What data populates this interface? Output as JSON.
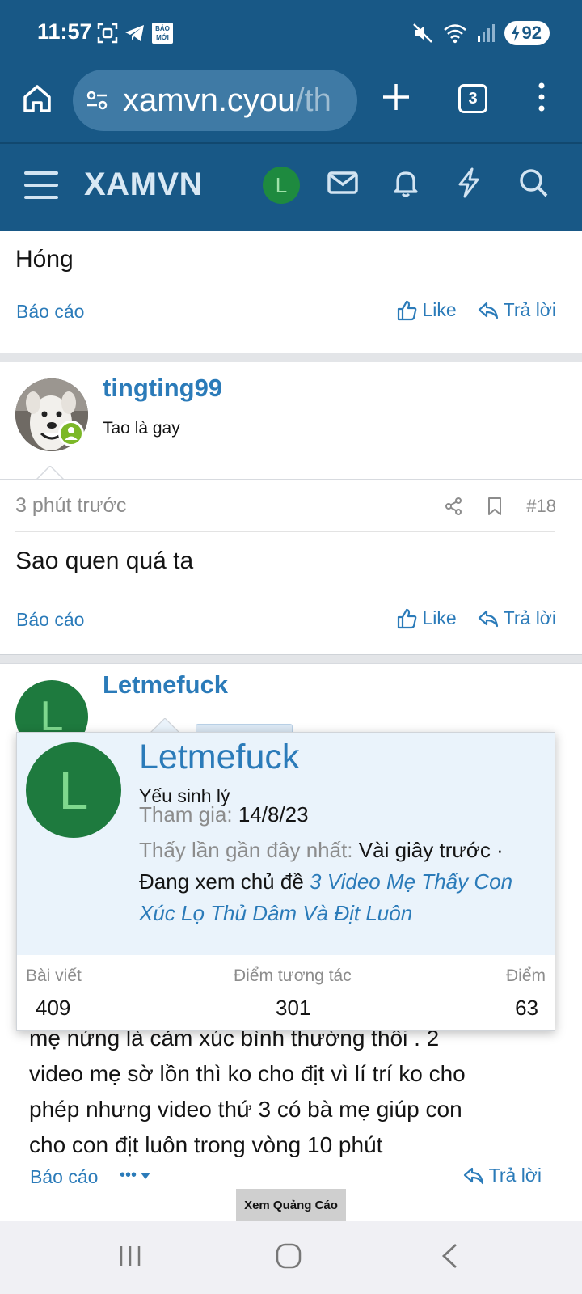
{
  "status_bar": {
    "time": "11:57",
    "battery": "92",
    "bao_moi_line1": "BÁO",
    "bao_moi_line2": "MỚI"
  },
  "browser": {
    "url_main": "xamvn.cyou",
    "url_rest": "/th",
    "tab_count": "3"
  },
  "site_header": {
    "logo": "XAMVN",
    "avatar_letter": "L"
  },
  "post_prev": {
    "text": "Hóng",
    "report": "Báo cáo",
    "like": "Like",
    "reply": "Trả lời"
  },
  "post_18": {
    "username": "tingting99",
    "user_title": "Tao là gay",
    "time": "3 phút trước",
    "number": "#18",
    "text": "Sao quen quá ta",
    "report": "Báo cáo",
    "like": "Like",
    "reply": "Trả lời"
  },
  "post_19": {
    "username": "Letmefuck",
    "avatar_letter": "L",
    "body_lines": [
      "mẹ nứng là cảm xúc bình thường thôi . 2",
      "video mẹ sờ lồn thì ko cho địt vì lí trí ko cho",
      "phép nhưng video thứ 3 có bà mẹ giúp con",
      "cho con địt luôn trong vòng 10 phút"
    ],
    "report": "Báo cáo",
    "more": "•••",
    "reply": "Trả lời",
    "ad_button": "Xem Quảng Cáo"
  },
  "popup": {
    "avatar_letter": "L",
    "name": "Letmefuck",
    "title": "Yếu sinh lý",
    "joined_label": "Tham gia:",
    "joined_value": "14/8/23",
    "last_seen_label": "Thấy lần gần đây nhất:",
    "last_seen_value": "Vài giây trước ·",
    "viewing": "Đang xem chủ đề",
    "thread_line1": "3 Video Mẹ Thấy Con",
    "thread_line2": "Xúc Lọ Thủ Dâm Và Địt Luôn",
    "stats": [
      {
        "label": "Bài viết",
        "value": "409"
      },
      {
        "label": "Điểm tương tác",
        "value": "301"
      },
      {
        "label": "Điểm",
        "value": "63"
      }
    ]
  },
  "colors": {
    "header": "#185886",
    "link": "#2b7bb9",
    "avatar_green": "#1e8a3f",
    "online": "#7cb828"
  }
}
